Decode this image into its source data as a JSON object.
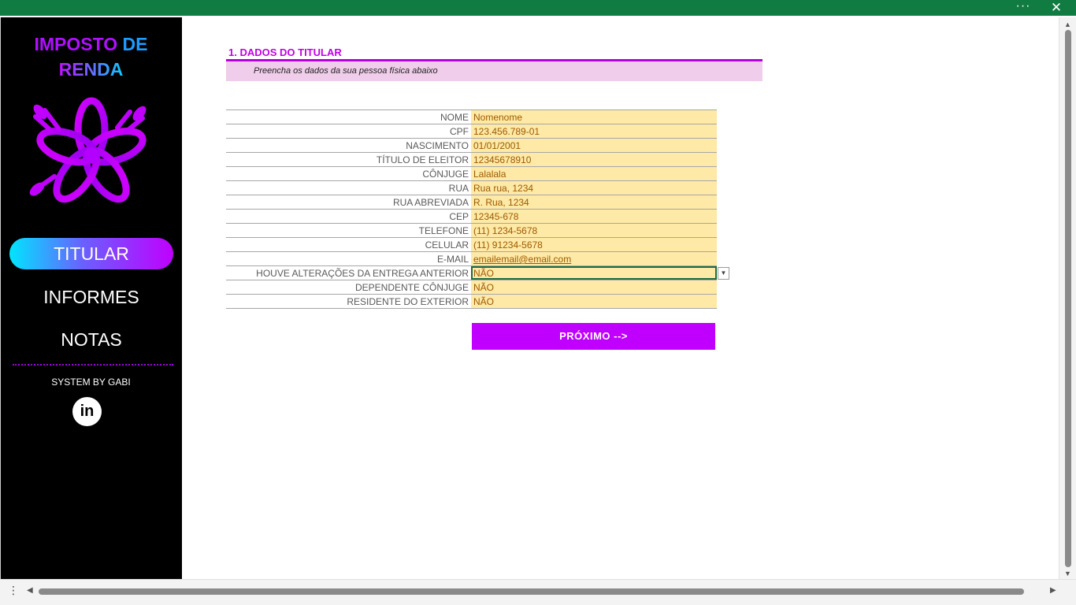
{
  "window": {
    "more_icon": "ellipsis-icon",
    "close_icon": "close-icon"
  },
  "sidebar": {
    "brand_line1_a": "IMPOSTO",
    "brand_line1_b": "DE",
    "brand_line2": "RENDA",
    "nav": {
      "titular": "TITULAR",
      "informes": "INFORMES",
      "notas": "NOTAS"
    },
    "system_by": "SYSTEM BY GABI",
    "linkedin_label": "in"
  },
  "section": {
    "title": "1. DADOS DO TITULAR",
    "subtitle": "Preencha os dados da sua pessoa física abaixo"
  },
  "form": {
    "fields": [
      {
        "label": "NOME",
        "value": "Nomenome"
      },
      {
        "label": "CPF",
        "value": "123.456.789-01"
      },
      {
        "label": "NASCIMENTO",
        "value": "01/01/2001"
      },
      {
        "label": "TÍTULO DE ELEITOR",
        "value": "12345678910"
      },
      {
        "label": "CÔNJUGE",
        "value": "Lalalala"
      },
      {
        "label": "RUA",
        "value": "Rua rua, 1234"
      },
      {
        "label": "RUA ABREVIADA",
        "value": "R. Rua, 1234"
      },
      {
        "label": "CEP",
        "value": "12345-678"
      },
      {
        "label": "TELEFONE",
        "value": "(11) 1234-5678"
      },
      {
        "label": "CELULAR",
        "value": "(11) 91234-5678"
      },
      {
        "label": "E-MAIL",
        "value": "emailemail@email.com"
      },
      {
        "label": "HOUVE ALTERAÇÕES DA ENTREGA ANTERIOR",
        "value": "NÃO"
      },
      {
        "label": "DEPENDENTE CÔNJUGE",
        "value": "NÃO"
      },
      {
        "label": "RESIDENTE DO EXTERIOR",
        "value": "NÃO"
      }
    ]
  },
  "next_button": "PRÓXIMO -->",
  "colors": {
    "accent": "#c000ff",
    "titlebar": "#107c41",
    "input_fill": "#ffe9a6",
    "subtitle_fill": "#f0cdea"
  }
}
